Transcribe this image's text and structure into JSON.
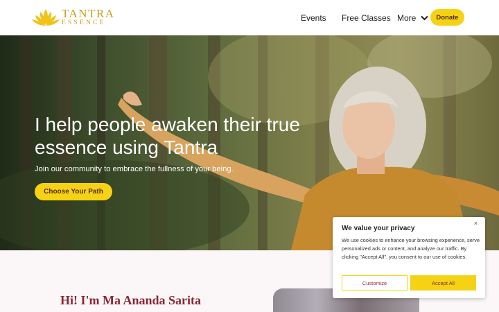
{
  "brand": {
    "title": "TANTRA",
    "subtitle": "ESSENCE",
    "logo_icon": "lotus-icon",
    "color": "#c99d20"
  },
  "nav": {
    "items": [
      {
        "label": "Events"
      },
      {
        "label": "Free Classes"
      },
      {
        "label": "More",
        "icon": "chevron-down-icon"
      }
    ],
    "donate_label": "Donate"
  },
  "hero": {
    "title": "I help people awaken their true essence using Tantra⁠",
    "subtitle": "Join our community to embrace the fullness of your being.",
    "cta_label": "Choose Your Path"
  },
  "intro": {
    "title": "Hi! I'm Ma Ananda Sarita"
  },
  "cookie_banner": {
    "title": "We value your privacy",
    "close_label": "×",
    "text": "We use cookies to enhance your browsing experience, serve personalized ads or content, and analyze our traffic. By clicking \"Accept All\", you consent to our use of cookies.",
    "customize_label": "Customize",
    "accept_label": "Accept All"
  },
  "colors": {
    "accent": "#f5d314",
    "heading": "#8a2535",
    "cta_text": "#5a2b1a"
  }
}
